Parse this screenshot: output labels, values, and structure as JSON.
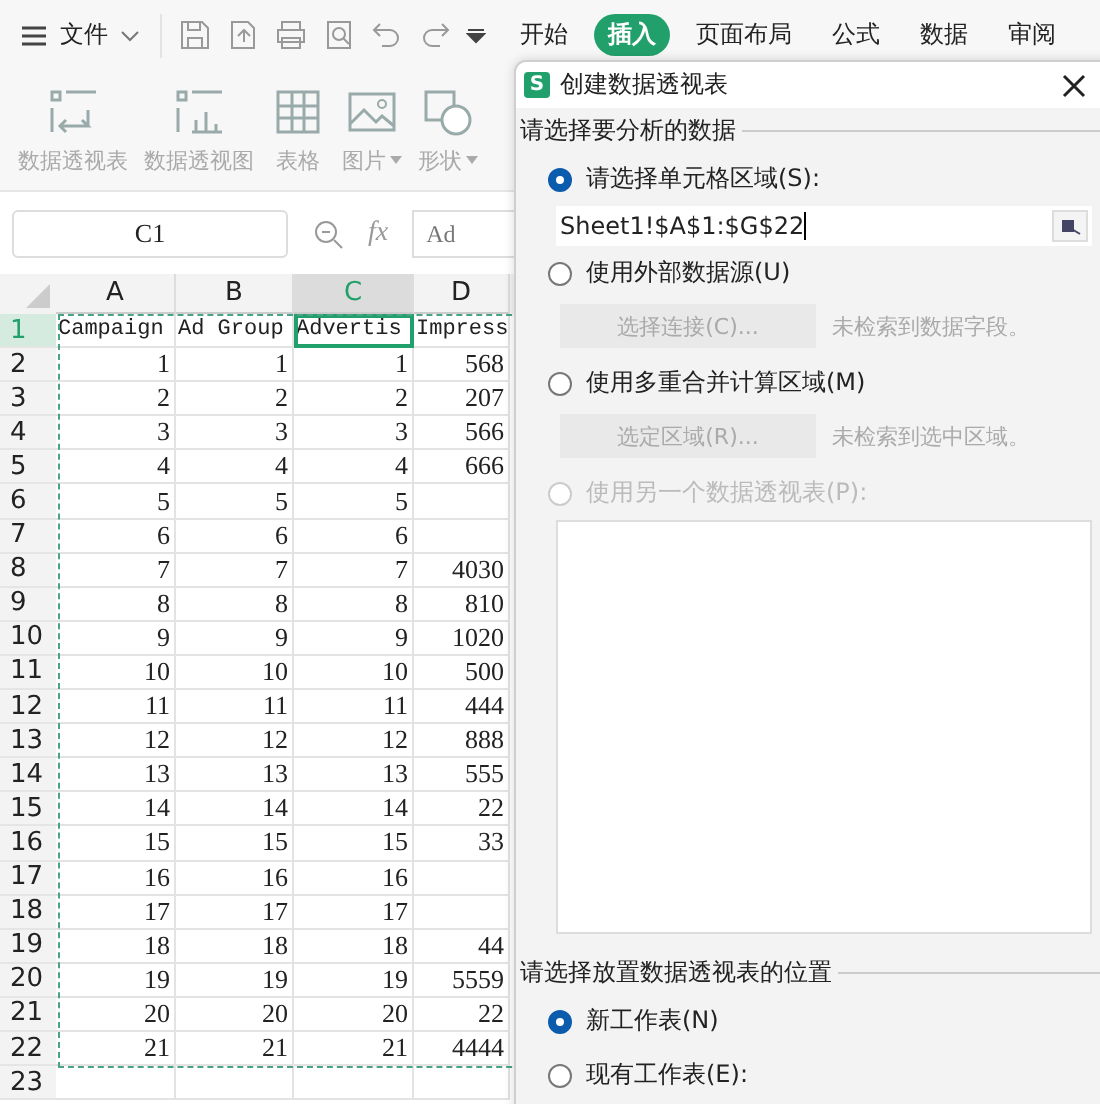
{
  "menu": {
    "label": "文件"
  },
  "tabs": [
    {
      "label": "开始",
      "selected": false
    },
    {
      "label": "插入",
      "selected": true
    },
    {
      "label": "页面布局",
      "selected": false
    },
    {
      "label": "公式",
      "selected": false
    },
    {
      "label": "数据",
      "selected": false
    },
    {
      "label": "审阅",
      "selected": false
    }
  ],
  "ribbon": [
    {
      "label": "数据透视表",
      "kind": "pivot",
      "dropdown": false
    },
    {
      "label": "数据透视图",
      "kind": "pivotchart",
      "dropdown": false
    },
    {
      "label": "表格",
      "kind": "table",
      "dropdown": false
    },
    {
      "label": "图片",
      "kind": "picture",
      "dropdown": true
    },
    {
      "label": "形状",
      "kind": "shape",
      "dropdown": true
    }
  ],
  "name_box": "C1",
  "function_label": "fx",
  "formula": "Ad",
  "sheet": {
    "columns": [
      {
        "label": "A",
        "selected": false
      },
      {
        "label": "B",
        "selected": false
      },
      {
        "label": "C",
        "selected": true
      },
      {
        "label": "D",
        "selected": false
      }
    ],
    "rows": [
      {
        "number": "1",
        "selected": true,
        "cells": [
          "Campaign",
          "Ad Group",
          "Advertis",
          "Impress"
        ]
      },
      {
        "number": "2",
        "selected": false,
        "cells": [
          "1",
          "1",
          "1",
          "568"
        ]
      },
      {
        "number": "3",
        "selected": false,
        "cells": [
          "2",
          "2",
          "2",
          "207"
        ]
      },
      {
        "number": "4",
        "selected": false,
        "cells": [
          "3",
          "3",
          "3",
          "566"
        ]
      },
      {
        "number": "5",
        "selected": false,
        "cells": [
          "4",
          "4",
          "4",
          "666"
        ]
      },
      {
        "number": "6",
        "selected": false,
        "cells": [
          "5",
          "5",
          "5",
          null
        ]
      },
      {
        "number": "7",
        "selected": false,
        "cells": [
          "6",
          "6",
          "6",
          null
        ]
      },
      {
        "number": "8",
        "selected": false,
        "cells": [
          "7",
          "7",
          "7",
          "4030"
        ]
      },
      {
        "number": "9",
        "selected": false,
        "cells": [
          "8",
          "8",
          "8",
          "810"
        ]
      },
      {
        "number": "10",
        "selected": false,
        "cells": [
          "9",
          "9",
          "9",
          "1020"
        ]
      },
      {
        "number": "11",
        "selected": false,
        "cells": [
          "10",
          "10",
          "10",
          "500"
        ]
      },
      {
        "number": "12",
        "selected": false,
        "cells": [
          "11",
          "11",
          "11",
          "444"
        ]
      },
      {
        "number": "13",
        "selected": false,
        "cells": [
          "12",
          "12",
          "12",
          "888"
        ]
      },
      {
        "number": "14",
        "selected": false,
        "cells": [
          "13",
          "13",
          "13",
          "555"
        ]
      },
      {
        "number": "15",
        "selected": false,
        "cells": [
          "14",
          "14",
          "14",
          "22"
        ]
      },
      {
        "number": "16",
        "selected": false,
        "cells": [
          "15",
          "15",
          "15",
          "33"
        ]
      },
      {
        "number": "17",
        "selected": false,
        "cells": [
          "16",
          "16",
          "16",
          null
        ]
      },
      {
        "number": "18",
        "selected": false,
        "cells": [
          "17",
          "17",
          "17",
          null
        ]
      },
      {
        "number": "19",
        "selected": false,
        "cells": [
          "18",
          "18",
          "18",
          "44"
        ]
      },
      {
        "number": "20",
        "selected": false,
        "cells": [
          "19",
          "19",
          "19",
          "5559"
        ]
      },
      {
        "number": "21",
        "selected": false,
        "cells": [
          "20",
          "20",
          "20",
          "22"
        ]
      },
      {
        "number": "22",
        "selected": false,
        "cells": [
          "21",
          "21",
          "21",
          "4444"
        ]
      },
      {
        "number": "23",
        "selected": false
      }
    ]
  },
  "dialog": {
    "icon_letter": "S",
    "title": "创建数据透视表",
    "source_heading": "请选择要分析的数据",
    "source_options": [
      {
        "kind": "range",
        "label": "请选择单元格区域(S):",
        "selected": true,
        "disabled": false,
        "value": "Sheet1!$A$1:$G$22"
      },
      {
        "kind": "button",
        "label": "使用外部数据源(U)",
        "selected": false,
        "disabled": false,
        "button": {
          "label": "选择连接(C)...",
          "disabled": true
        },
        "note": "未检索到数据字段。"
      },
      {
        "kind": "button",
        "label": "使用多重合并计算区域(M)",
        "selected": false,
        "disabled": false,
        "button": {
          "label": "选定区域(R)...",
          "disabled": true
        },
        "note": "未检索到选中区域。"
      },
      {
        "kind": "list",
        "label": "使用另一个数据透视表(P):",
        "selected": false,
        "disabled": true
      }
    ],
    "destination_heading": "请选择放置数据透视表的位置",
    "destination_options": [
      {
        "label": "新工作表(N)",
        "selected": true,
        "disabled": false
      },
      {
        "label": "现有工作表(E):",
        "selected": false,
        "disabled": false
      }
    ]
  }
}
